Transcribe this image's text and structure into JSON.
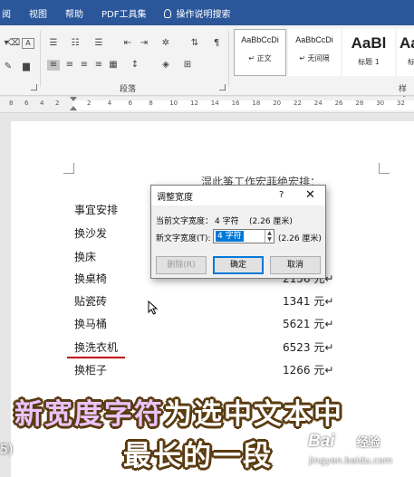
{
  "menu": {
    "items": [
      "阅",
      "视图",
      "帮助",
      "PDF工具集"
    ],
    "tell_me": "操作说明搜索"
  },
  "ribbon": {
    "paragraph_group_label": "段落",
    "styles_group_label": "样式",
    "styles": [
      {
        "sample": "AaBbCcDi",
        "name": "↵ 正文"
      },
      {
        "sample": "AaBbCcDi",
        "name": "↵ 无间隔"
      },
      {
        "sample": "AaBl",
        "name": "标题 1"
      },
      {
        "sample": "AaB",
        "name": "标题"
      }
    ]
  },
  "ruler": {
    "ticks": [
      "8",
      "6",
      "4",
      "2",
      "2",
      "4",
      "6",
      "8",
      "10",
      "12",
      "14",
      "16",
      "18",
      "20",
      "22",
      "24",
      "26",
      "28",
      "30",
      "32"
    ]
  },
  "document": {
    "heading_fragment": "湿此筝工作宏菲绝宏排：",
    "rows": [
      {
        "item": "事宜安排",
        "amount": ""
      },
      {
        "item": "换沙发",
        "amount": ""
      },
      {
        "item": "换床",
        "amount": ""
      },
      {
        "item": "换桌椅",
        "amount": "2156 元↵"
      },
      {
        "item": "贴瓷砖",
        "amount": "1341 元↵"
      },
      {
        "item": "换马桶",
        "amount": "5621 元↵"
      },
      {
        "item": "换洗衣机",
        "amount": "6523 元↵"
      },
      {
        "item": "换柜子",
        "amount": "1266 元↵"
      }
    ]
  },
  "dialog": {
    "title": "调整宽度",
    "help": "?",
    "close": "✕",
    "current_label": "当前文字宽度：",
    "current_value": "4 字符",
    "current_cm": "(2.26 厘米)",
    "new_label": "新文字宽度(T):",
    "new_value": "4 字符",
    "new_cm": "(2.26 厘米)",
    "delete_button": "删除(R)",
    "ok_button": "确定",
    "cancel_button": "取消"
  },
  "captions": {
    "line1_part1": "新宽度字符",
    "line1_part2": "为选中文本中",
    "line2": "最长的一段",
    "side_text": "5)"
  },
  "watermark": {
    "brand_left": "Bai",
    "brand_right": "经验",
    "url": "jingyan.baidu.com"
  },
  "colors": {
    "menubar": "#2b579a",
    "caption_fill": "#ffffff",
    "caption_highlight": "#e9c4ff",
    "caption_outline": "#5a3b10",
    "underline": "#c00000"
  }
}
